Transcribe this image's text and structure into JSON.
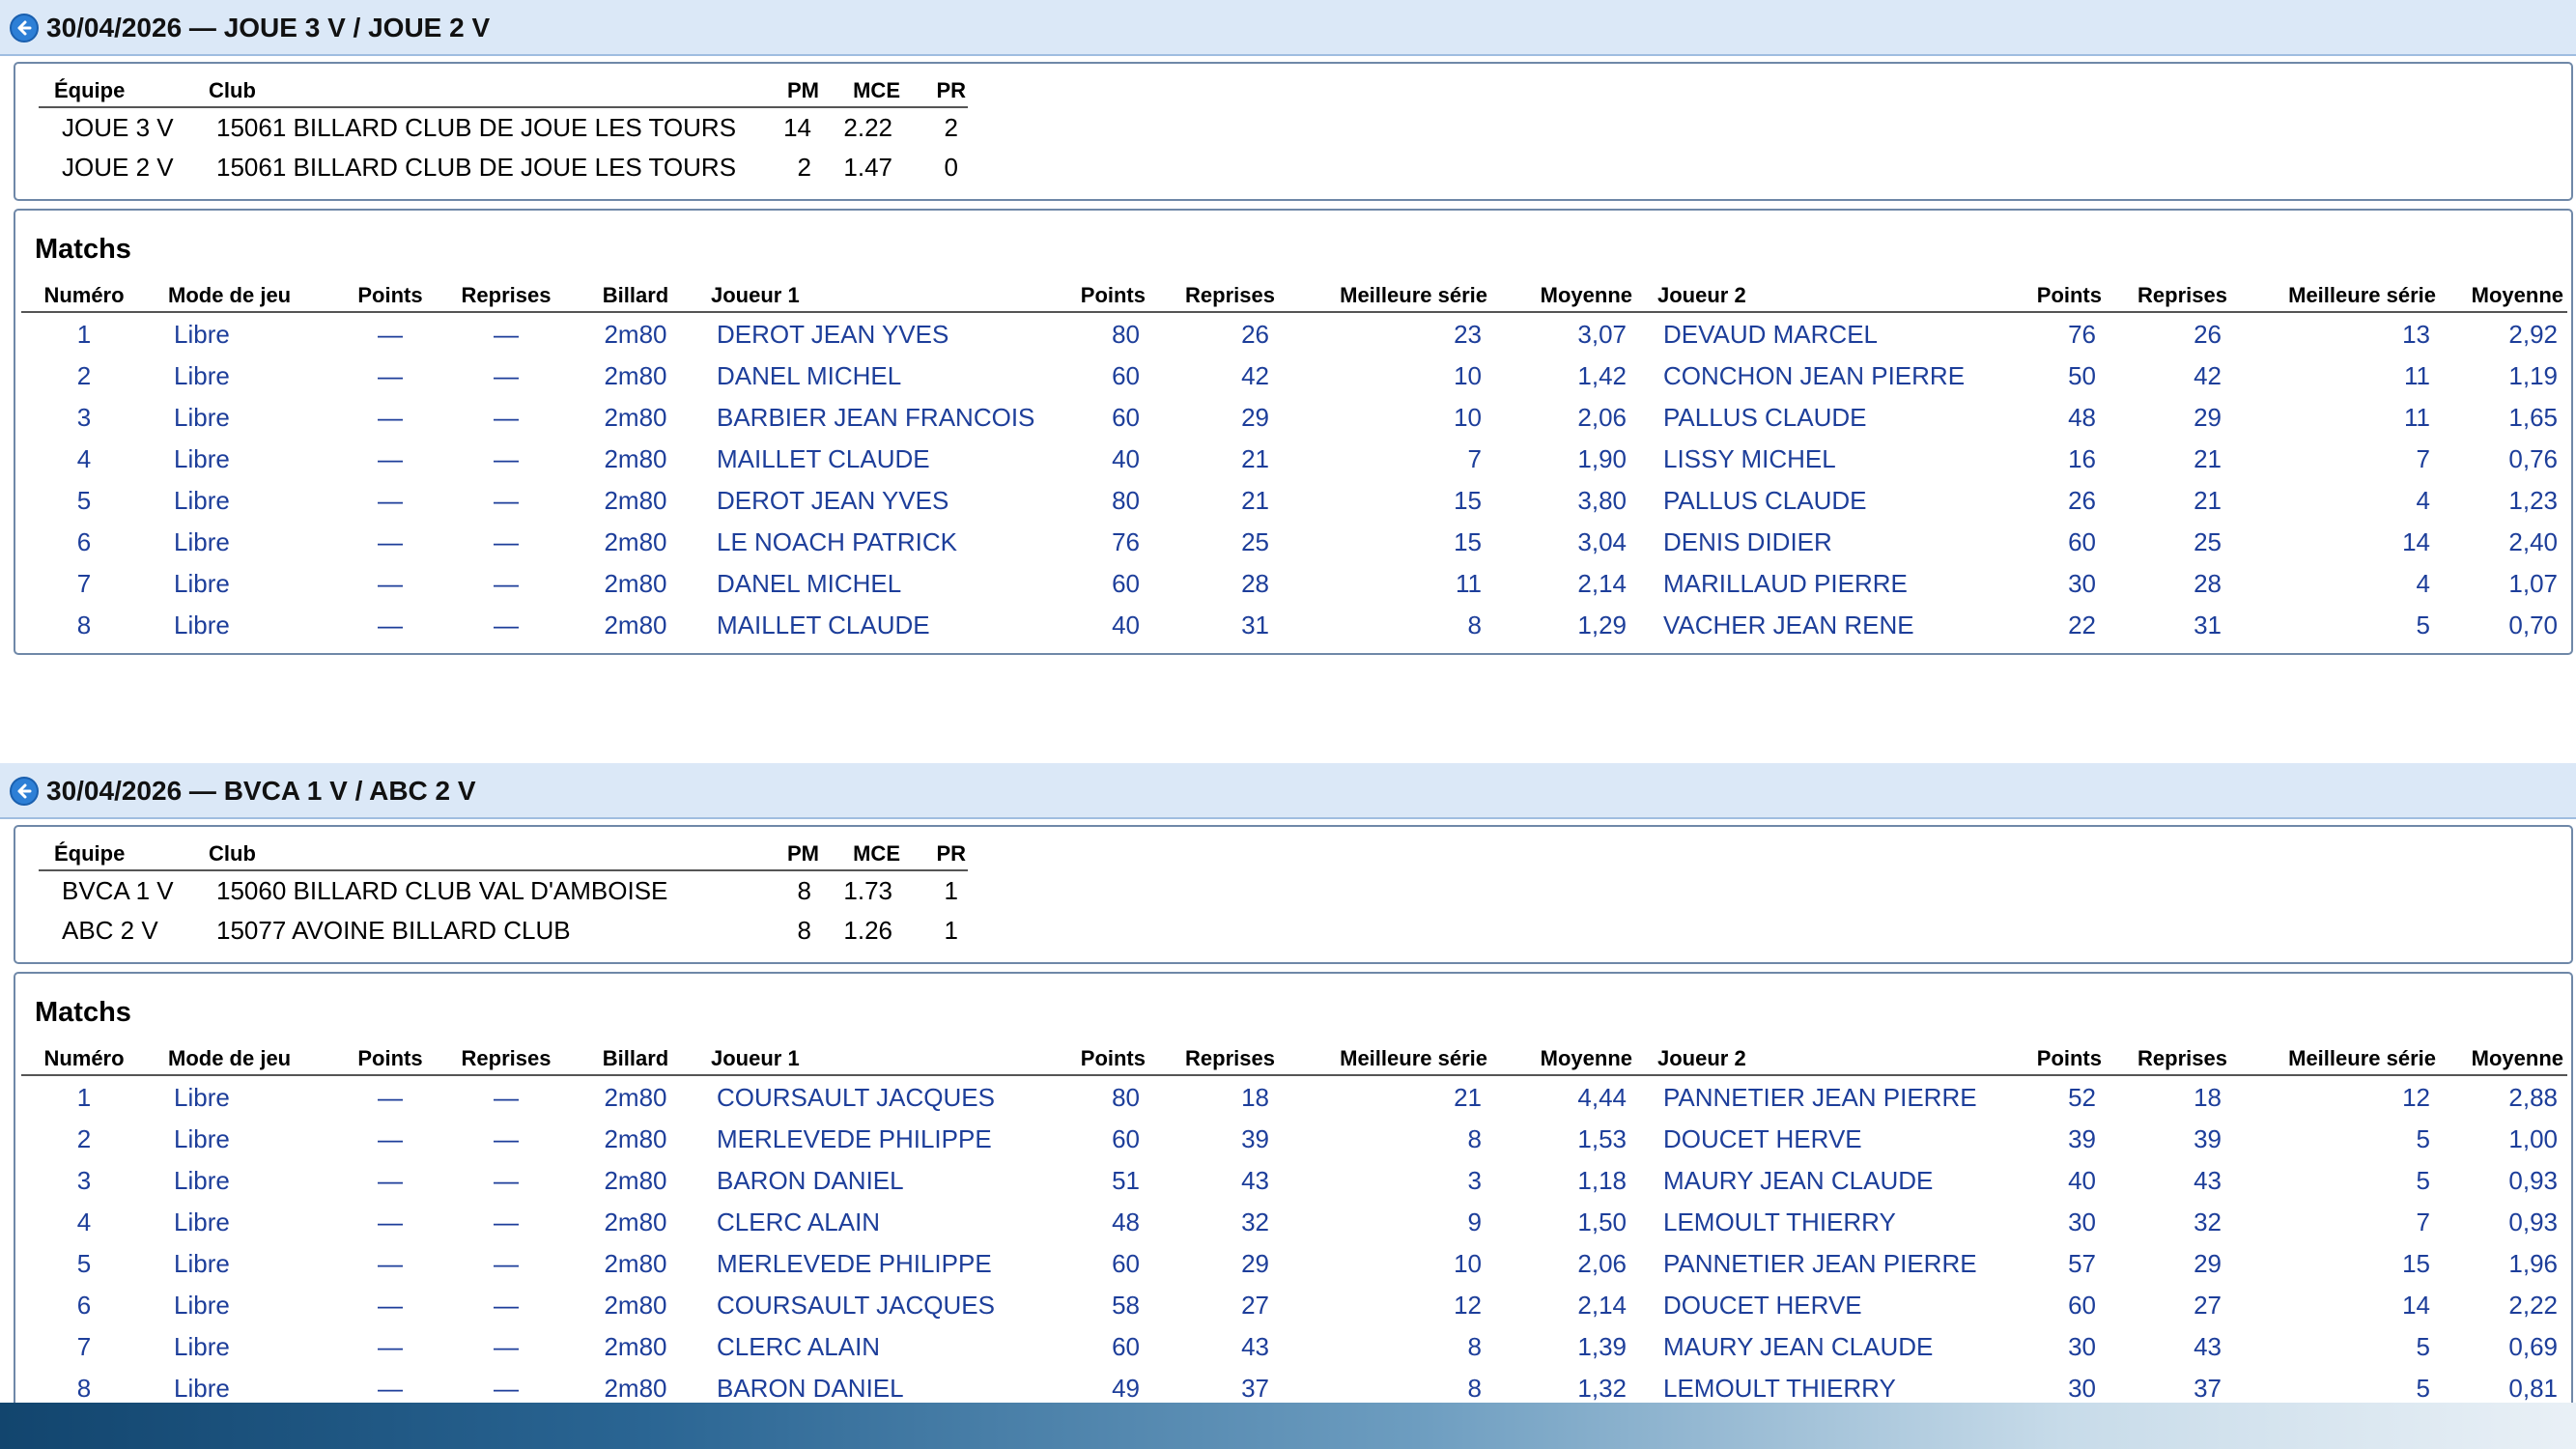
{
  "sections": [
    {
      "title": "30/04/2026 — JOUE 3 V / JOUE 2 V",
      "team_headers": {
        "equipe": "Équipe",
        "club": "Club",
        "pm": "PM",
        "mce": "MCE",
        "pr": "PR"
      },
      "teams": [
        {
          "equipe": "JOUE 3 V",
          "club": "15061 BILLARD CLUB DE JOUE LES TOURS",
          "pm": "14",
          "mce": "2.22",
          "pr": "2"
        },
        {
          "equipe": "JOUE 2 V",
          "club": "15061 BILLARD CLUB DE JOUE LES TOURS",
          "pm": "2",
          "mce": "1.47",
          "pr": "0"
        }
      ],
      "matchs_title": "Matchs",
      "match_headers": {
        "numero": "Numéro",
        "mode": "Mode de jeu",
        "points": "Points",
        "reprises": "Reprises",
        "billard": "Billard",
        "joueur1": "Joueur 1",
        "points1": "Points",
        "reprises1": "Reprises",
        "serie1": "Meilleure série",
        "moyenne1": "Moyenne",
        "joueur2": "Joueur 2",
        "points2": "Points",
        "reprises2": "Reprises",
        "serie2": "Meilleure série",
        "moyenne2": "Moyenne"
      },
      "matches": [
        {
          "numero": "1",
          "mode": "Libre",
          "points": "—",
          "reprises": "—",
          "billard": "2m80",
          "joueur1": "DEROT JEAN YVES",
          "points1": "80",
          "reprises1": "26",
          "serie1": "23",
          "moyenne1": "3,07",
          "joueur2": "DEVAUD MARCEL",
          "points2": "76",
          "reprises2": "26",
          "serie2": "13",
          "moyenne2": "2,92"
        },
        {
          "numero": "2",
          "mode": "Libre",
          "points": "—",
          "reprises": "—",
          "billard": "2m80",
          "joueur1": "DANEL MICHEL",
          "points1": "60",
          "reprises1": "42",
          "serie1": "10",
          "moyenne1": "1,42",
          "joueur2": "CONCHON JEAN PIERRE",
          "points2": "50",
          "reprises2": "42",
          "serie2": "11",
          "moyenne2": "1,19"
        },
        {
          "numero": "3",
          "mode": "Libre",
          "points": "—",
          "reprises": "—",
          "billard": "2m80",
          "joueur1": "BARBIER JEAN FRANCOIS",
          "points1": "60",
          "reprises1": "29",
          "serie1": "10",
          "moyenne1": "2,06",
          "joueur2": "PALLUS CLAUDE",
          "points2": "48",
          "reprises2": "29",
          "serie2": "11",
          "moyenne2": "1,65"
        },
        {
          "numero": "4",
          "mode": "Libre",
          "points": "—",
          "reprises": "—",
          "billard": "2m80",
          "joueur1": "MAILLET CLAUDE",
          "points1": "40",
          "reprises1": "21",
          "serie1": "7",
          "moyenne1": "1,90",
          "joueur2": "LISSY MICHEL",
          "points2": "16",
          "reprises2": "21",
          "serie2": "7",
          "moyenne2": "0,76"
        },
        {
          "numero": "5",
          "mode": "Libre",
          "points": "—",
          "reprises": "—",
          "billard": "2m80",
          "joueur1": "DEROT JEAN YVES",
          "points1": "80",
          "reprises1": "21",
          "serie1": "15",
          "moyenne1": "3,80",
          "joueur2": "PALLUS CLAUDE",
          "points2": "26",
          "reprises2": "21",
          "serie2": "4",
          "moyenne2": "1,23"
        },
        {
          "numero": "6",
          "mode": "Libre",
          "points": "—",
          "reprises": "—",
          "billard": "2m80",
          "joueur1": "LE NOACH PATRICK",
          "points1": "76",
          "reprises1": "25",
          "serie1": "15",
          "moyenne1": "3,04",
          "joueur2": "DENIS DIDIER",
          "points2": "60",
          "reprises2": "25",
          "serie2": "14",
          "moyenne2": "2,40"
        },
        {
          "numero": "7",
          "mode": "Libre",
          "points": "—",
          "reprises": "—",
          "billard": "2m80",
          "joueur1": "DANEL MICHEL",
          "points1": "60",
          "reprises1": "28",
          "serie1": "11",
          "moyenne1": "2,14",
          "joueur2": "MARILLAUD PIERRE",
          "points2": "30",
          "reprises2": "28",
          "serie2": "4",
          "moyenne2": "1,07"
        },
        {
          "numero": "8",
          "mode": "Libre",
          "points": "—",
          "reprises": "—",
          "billard": "2m80",
          "joueur1": "MAILLET CLAUDE",
          "points1": "40",
          "reprises1": "31",
          "serie1": "8",
          "moyenne1": "1,29",
          "joueur2": "VACHER JEAN RENE",
          "points2": "22",
          "reprises2": "31",
          "serie2": "5",
          "moyenne2": "0,70"
        }
      ]
    },
    {
      "title": "30/04/2026 — BVCA 1 V / ABC 2 V",
      "team_headers": {
        "equipe": "Équipe",
        "club": "Club",
        "pm": "PM",
        "mce": "MCE",
        "pr": "PR"
      },
      "teams": [
        {
          "equipe": "BVCA 1 V",
          "club": "15060 BILLARD CLUB VAL D'AMBOISE",
          "pm": "8",
          "mce": "1.73",
          "pr": "1"
        },
        {
          "equipe": "ABC 2 V",
          "club": "15077 AVOINE BILLARD CLUB",
          "pm": "8",
          "mce": "1.26",
          "pr": "1"
        }
      ],
      "matchs_title": "Matchs",
      "match_headers": {
        "numero": "Numéro",
        "mode": "Mode de jeu",
        "points": "Points",
        "reprises": "Reprises",
        "billard": "Billard",
        "joueur1": "Joueur 1",
        "points1": "Points",
        "reprises1": "Reprises",
        "serie1": "Meilleure série",
        "moyenne1": "Moyenne",
        "joueur2": "Joueur 2",
        "points2": "Points",
        "reprises2": "Reprises",
        "serie2": "Meilleure série",
        "moyenne2": "Moyenne"
      },
      "matches": [
        {
          "numero": "1",
          "mode": "Libre",
          "points": "—",
          "reprises": "—",
          "billard": "2m80",
          "joueur1": "COURSAULT JACQUES",
          "points1": "80",
          "reprises1": "18",
          "serie1": "21",
          "moyenne1": "4,44",
          "joueur2": "PANNETIER JEAN PIERRE",
          "points2": "52",
          "reprises2": "18",
          "serie2": "12",
          "moyenne2": "2,88"
        },
        {
          "numero": "2",
          "mode": "Libre",
          "points": "—",
          "reprises": "—",
          "billard": "2m80",
          "joueur1": "MERLEVEDE PHILIPPE",
          "points1": "60",
          "reprises1": "39",
          "serie1": "8",
          "moyenne1": "1,53",
          "joueur2": "DOUCET HERVE",
          "points2": "39",
          "reprises2": "39",
          "serie2": "5",
          "moyenne2": "1,00"
        },
        {
          "numero": "3",
          "mode": "Libre",
          "points": "—",
          "reprises": "—",
          "billard": "2m80",
          "joueur1": "BARON DANIEL",
          "points1": "51",
          "reprises1": "43",
          "serie1": "3",
          "moyenne1": "1,18",
          "joueur2": "MAURY JEAN CLAUDE",
          "points2": "40",
          "reprises2": "43",
          "serie2": "5",
          "moyenne2": "0,93"
        },
        {
          "numero": "4",
          "mode": "Libre",
          "points": "—",
          "reprises": "—",
          "billard": "2m80",
          "joueur1": "CLERC ALAIN",
          "points1": "48",
          "reprises1": "32",
          "serie1": "9",
          "moyenne1": "1,50",
          "joueur2": "LEMOULT THIERRY",
          "points2": "30",
          "reprises2": "32",
          "serie2": "7",
          "moyenne2": "0,93"
        },
        {
          "numero": "5",
          "mode": "Libre",
          "points": "—",
          "reprises": "—",
          "billard": "2m80",
          "joueur1": "MERLEVEDE PHILIPPE",
          "points1": "60",
          "reprises1": "29",
          "serie1": "10",
          "moyenne1": "2,06",
          "joueur2": "PANNETIER JEAN PIERRE",
          "points2": "57",
          "reprises2": "29",
          "serie2": "15",
          "moyenne2": "1,96"
        },
        {
          "numero": "6",
          "mode": "Libre",
          "points": "—",
          "reprises": "—",
          "billard": "2m80",
          "joueur1": "COURSAULT JACQUES",
          "points1": "58",
          "reprises1": "27",
          "serie1": "12",
          "moyenne1": "2,14",
          "joueur2": "DOUCET HERVE",
          "points2": "60",
          "reprises2": "27",
          "serie2": "14",
          "moyenne2": "2,22"
        },
        {
          "numero": "7",
          "mode": "Libre",
          "points": "—",
          "reprises": "—",
          "billard": "2m80",
          "joueur1": "CLERC ALAIN",
          "points1": "60",
          "reprises1": "43",
          "serie1": "8",
          "moyenne1": "1,39",
          "joueur2": "MAURY JEAN CLAUDE",
          "points2": "30",
          "reprises2": "43",
          "serie2": "5",
          "moyenne2": "0,69"
        },
        {
          "numero": "8",
          "mode": "Libre",
          "points": "—",
          "reprises": "—",
          "billard": "2m80",
          "joueur1": "BARON DANIEL",
          "points1": "49",
          "reprises1": "37",
          "serie1": "8",
          "moyenne1": "1,32",
          "joueur2": "LEMOULT THIERRY",
          "points2": "30",
          "reprises2": "37",
          "serie2": "5",
          "moyenne2": "0,81"
        }
      ]
    }
  ]
}
